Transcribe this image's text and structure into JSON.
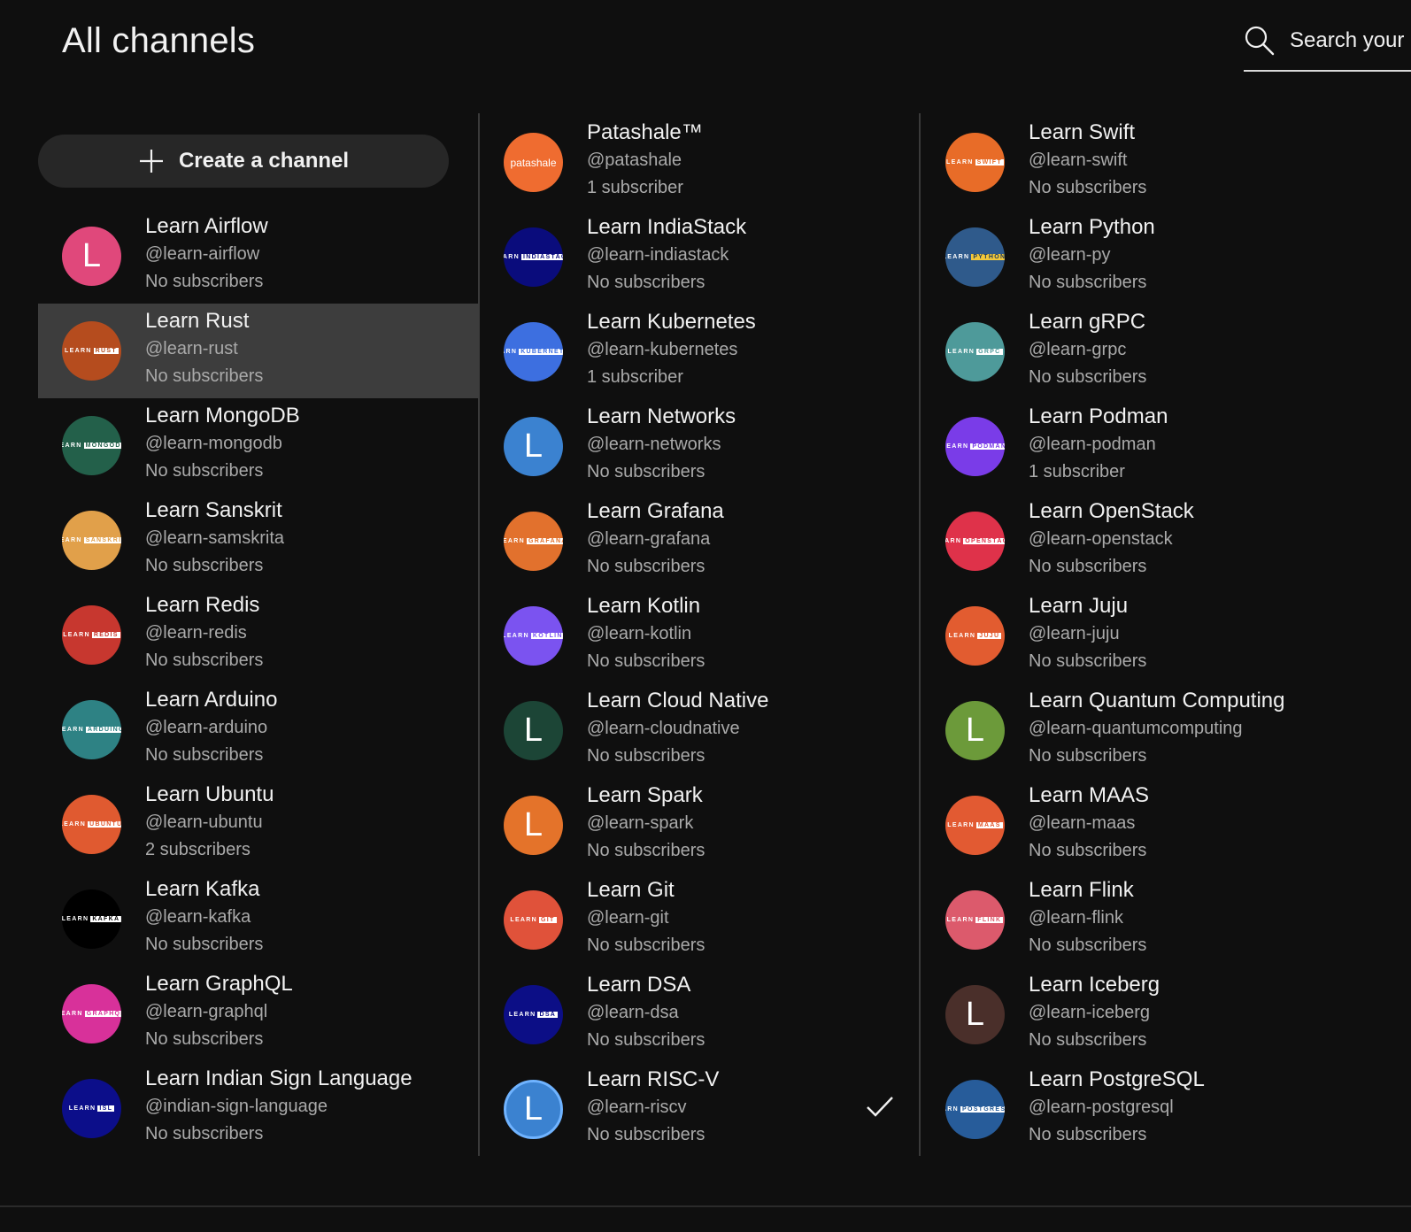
{
  "page": {
    "title": "All channels"
  },
  "search": {
    "placeholder": "Search your"
  },
  "create_button": {
    "label": "Create a channel"
  },
  "columns": [
    {
      "channels": [
        {
          "name": "Learn Airflow",
          "handle": "@learn-airflow",
          "subscribers": "No subscribers",
          "avatar": {
            "type": "letter",
            "letter": "L",
            "bg": "#e0487b"
          }
        },
        {
          "name": "Learn Rust",
          "handle": "@learn-rust",
          "subscribers": "No subscribers",
          "selected": true,
          "avatar": {
            "type": "wordmark",
            "tag": "RUST",
            "bg": "#b54c1e"
          }
        },
        {
          "name": "Learn MongoDB",
          "handle": "@learn-mongodb",
          "subscribers": "No subscribers",
          "avatar": {
            "type": "wordmark",
            "tag": "MONGODB",
            "bg": "#23604a"
          }
        },
        {
          "name": "Learn Sanskrit",
          "handle": "@learn-samskrita",
          "subscribers": "No subscribers",
          "avatar": {
            "type": "wordmark",
            "tag": "SANSKRIT",
            "bg": "#e1a04a"
          }
        },
        {
          "name": "Learn Redis",
          "handle": "@learn-redis",
          "subscribers": "No subscribers",
          "avatar": {
            "type": "wordmark",
            "tag": "REDIS",
            "bg": "#c7372f"
          }
        },
        {
          "name": "Learn Arduino",
          "handle": "@learn-arduino",
          "subscribers": "No subscribers",
          "avatar": {
            "type": "wordmark",
            "tag": "ARDUINO",
            "bg": "#2e8284"
          }
        },
        {
          "name": "Learn Ubuntu",
          "handle": "@learn-ubuntu",
          "subscribers": "2 subscribers",
          "avatar": {
            "type": "wordmark",
            "tag": "UBUNTU",
            "bg": "#e05a30"
          }
        },
        {
          "name": "Learn Kafka",
          "handle": "@learn-kafka",
          "subscribers": "No subscribers",
          "avatar": {
            "type": "wordmark",
            "tag": "KAFKA",
            "bg": "#000000"
          }
        },
        {
          "name": "Learn GraphQL",
          "handle": "@learn-graphql",
          "subscribers": "No subscribers",
          "avatar": {
            "type": "wordmark",
            "tag": "GRAPHQL",
            "bg": "#d8319a"
          }
        },
        {
          "name": "Learn Indian Sign Language",
          "handle": "@indian-sign-language",
          "subscribers": "No subscribers",
          "avatar": {
            "type": "wordmark",
            "tag": "ISL",
            "bg": "#0c0e8a"
          }
        }
      ]
    },
    {
      "channels": [
        {
          "name": "Patashale™",
          "handle": "@patashale",
          "subscribers": "1 subscriber",
          "avatar": {
            "type": "patashale",
            "text": "patashale",
            "bg": "#ef6c30"
          }
        },
        {
          "name": "Learn IndiaStack",
          "handle": "@learn-indiastack",
          "subscribers": "No subscribers",
          "avatar": {
            "type": "wordmark",
            "tag": "INDIASTACK",
            "bg": "#0a0c7c"
          }
        },
        {
          "name": "Learn Kubernetes",
          "handle": "@learn-kubernetes",
          "subscribers": "1 subscriber",
          "avatar": {
            "type": "wordmark",
            "tag": "KUBERNETES",
            "bg": "#3d6fe0"
          }
        },
        {
          "name": "Learn Networks",
          "handle": "@learn-networks",
          "subscribers": "No subscribers",
          "avatar": {
            "type": "letter",
            "letter": "L",
            "bg": "#3b82d0"
          }
        },
        {
          "name": "Learn Grafana",
          "handle": "@learn-grafana",
          "subscribers": "No subscribers",
          "avatar": {
            "type": "wordmark",
            "tag": "GRAFANA",
            "bg": "#e2712d"
          }
        },
        {
          "name": "Learn Kotlin",
          "handle": "@learn-kotlin",
          "subscribers": "No subscribers",
          "avatar": {
            "type": "wordmark",
            "tag": "KOTLIN",
            "bg": "#7b53f0"
          }
        },
        {
          "name": "Learn Cloud Native",
          "handle": "@learn-cloudnative",
          "subscribers": "No subscribers",
          "avatar": {
            "type": "letter",
            "letter": "L",
            "bg": "#1c4536"
          }
        },
        {
          "name": "Learn Spark",
          "handle": "@learn-spark",
          "subscribers": "No subscribers",
          "avatar": {
            "type": "letter",
            "letter": "L",
            "bg": "#e4732a"
          }
        },
        {
          "name": "Learn Git",
          "handle": "@learn-git",
          "subscribers": "No subscribers",
          "avatar": {
            "type": "wordmark",
            "tag": "GIT",
            "bg": "#e0523a"
          }
        },
        {
          "name": "Learn DSA",
          "handle": "@learn-dsa",
          "subscribers": "No subscribers",
          "avatar": {
            "type": "wordmark",
            "tag": "DSA",
            "bg": "#0c0e86"
          }
        },
        {
          "name": "Learn RISC-V",
          "handle": "@learn-riscv",
          "subscribers": "No subscribers",
          "current": true,
          "avatar": {
            "type": "letter",
            "letter": "L",
            "bg": "#3b82d0",
            "ring": true
          }
        }
      ]
    },
    {
      "channels": [
        {
          "name": "Learn Swift",
          "handle": "@learn-swift",
          "subscribers": "No subscribers",
          "avatar": {
            "type": "wordmark",
            "tag": "SWIFT",
            "bg": "#e86c28"
          }
        },
        {
          "name": "Learn Python",
          "handle": "@learn-py",
          "subscribers": "No subscribers",
          "avatar": {
            "type": "wordmark",
            "tag": "PYTHON",
            "bg": "#2f5a8b",
            "tag_bg": "#f3c83a"
          }
        },
        {
          "name": "Learn gRPC",
          "handle": "@learn-grpc",
          "subscribers": "No subscribers",
          "avatar": {
            "type": "wordmark",
            "tag": "GRPC",
            "bg": "#4e9a9a"
          }
        },
        {
          "name": "Learn Podman",
          "handle": "@learn-podman",
          "subscribers": "1 subscriber",
          "avatar": {
            "type": "wordmark",
            "tag": "PODMAN",
            "bg": "#7a3ce8"
          }
        },
        {
          "name": "Learn OpenStack",
          "handle": "@learn-openstack",
          "subscribers": "No subscribers",
          "avatar": {
            "type": "wordmark",
            "tag": "OPENSTACK",
            "bg": "#df324a"
          }
        },
        {
          "name": "Learn Juju",
          "handle": "@learn-juju",
          "subscribers": "No subscribers",
          "avatar": {
            "type": "wordmark",
            "tag": "JUJU",
            "bg": "#e25c30"
          }
        },
        {
          "name": "Learn Quantum Computing",
          "handle": "@learn-quantumcomputing",
          "subscribers": "No subscribers",
          "avatar": {
            "type": "letter",
            "letter": "L",
            "bg": "#6c9a3a"
          }
        },
        {
          "name": "Learn MAAS",
          "handle": "@learn-maas",
          "subscribers": "No subscribers",
          "avatar": {
            "type": "wordmark",
            "tag": "MAAS",
            "bg": "#e25a32"
          }
        },
        {
          "name": "Learn Flink",
          "handle": "@learn-flink",
          "subscribers": "No subscribers",
          "avatar": {
            "type": "wordmark",
            "tag": "FLINK",
            "bg": "#dc5a6c"
          }
        },
        {
          "name": "Learn Iceberg",
          "handle": "@learn-iceberg",
          "subscribers": "No subscribers",
          "avatar": {
            "type": "letter",
            "letter": "L",
            "bg": "#4a2f2a"
          }
        },
        {
          "name": "Learn PostgreSQL",
          "handle": "@learn-postgresql",
          "subscribers": "No subscribers",
          "avatar": {
            "type": "wordmark",
            "tag": "POSTGRESQL",
            "bg": "#275c9a"
          }
        }
      ]
    }
  ],
  "icons": {
    "search": "search-icon",
    "plus": "plus-icon",
    "check": "check-icon"
  },
  "colors": {
    "background": "#0f0f0f",
    "selected_row": "#3d3d3d",
    "button_bg": "#272727",
    "divider": "#3a3a3a",
    "secondary_text": "#aaaaaa"
  }
}
